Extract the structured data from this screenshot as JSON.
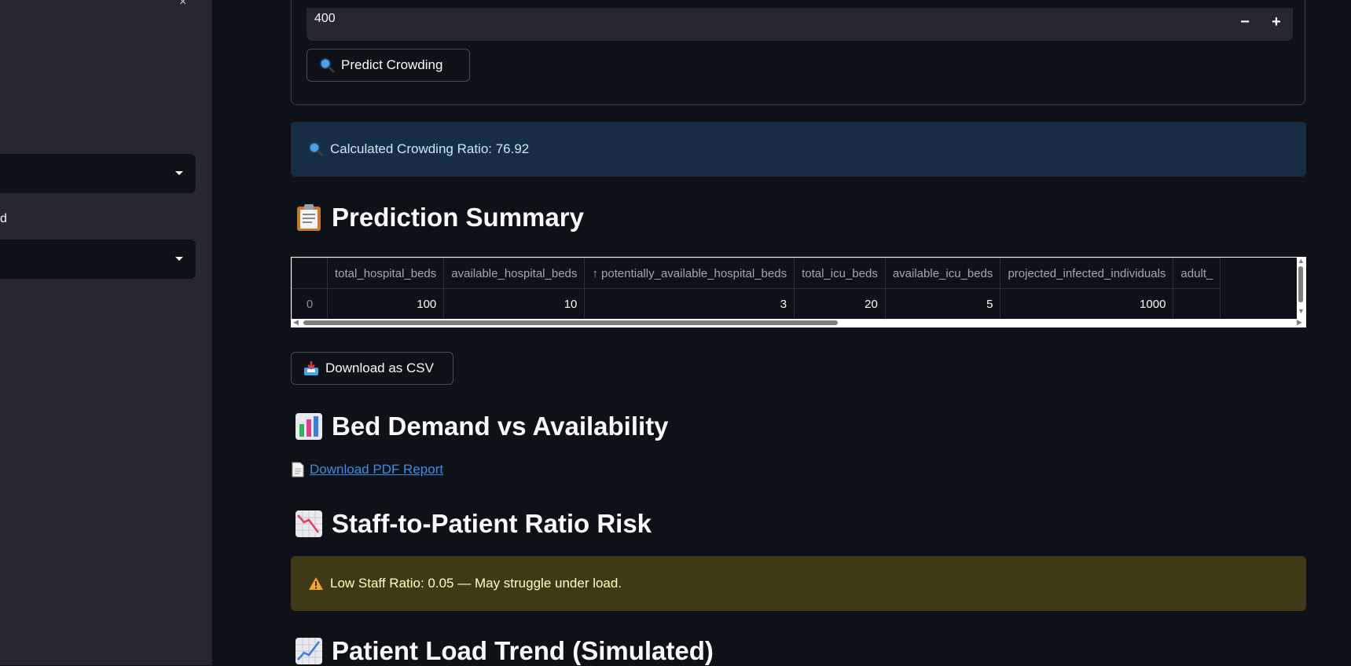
{
  "sidebar": {
    "close_glyph": "×",
    "label_fragment": "d"
  },
  "form": {
    "number_value": "400",
    "minus": "−",
    "plus": "+",
    "predict_button": "Predict Crowding"
  },
  "info": {
    "text": "Calculated Crowding Ratio: 76.92"
  },
  "sections": {
    "prediction_summary": "Prediction Summary",
    "bed_demand": "Bed Demand vs Availability",
    "staff_ratio": "Staff-to-Patient Ratio Risk",
    "patient_trend": "Patient Load Trend (Simulated)"
  },
  "table": {
    "columns": [
      "",
      "total_hospital_beds",
      "available_hospital_beds",
      "↑ potentially_available_hospital_beds",
      "total_icu_beds",
      "available_icu_beds",
      "projected_infected_individuals",
      "adult_"
    ],
    "rows": [
      [
        "0",
        "100",
        "10",
        "3",
        "20",
        "5",
        "1000",
        ""
      ]
    ]
  },
  "download_csv": "Download as CSV",
  "pdf_link": "Download PDF Report",
  "warning": {
    "text": "Low Staff Ratio: 0.05 — May struggle under load."
  },
  "colors": {
    "background": "#0e1117",
    "sidebar": "#262730",
    "info_bg": "#172d43",
    "warning_bg": "#3e3a16",
    "link": "#3a8ee6"
  },
  "icons": {
    "predict": "magnifier-icon",
    "info": "magnifier-icon",
    "summary": "clipboard-icon",
    "csv": "inbox-tray-icon",
    "bed_chart": "bar-chart-icon",
    "pdf": "page-icon",
    "staff": "chart-decreasing-icon",
    "warning": "warning-icon",
    "trend": "chart-increasing-icon"
  }
}
